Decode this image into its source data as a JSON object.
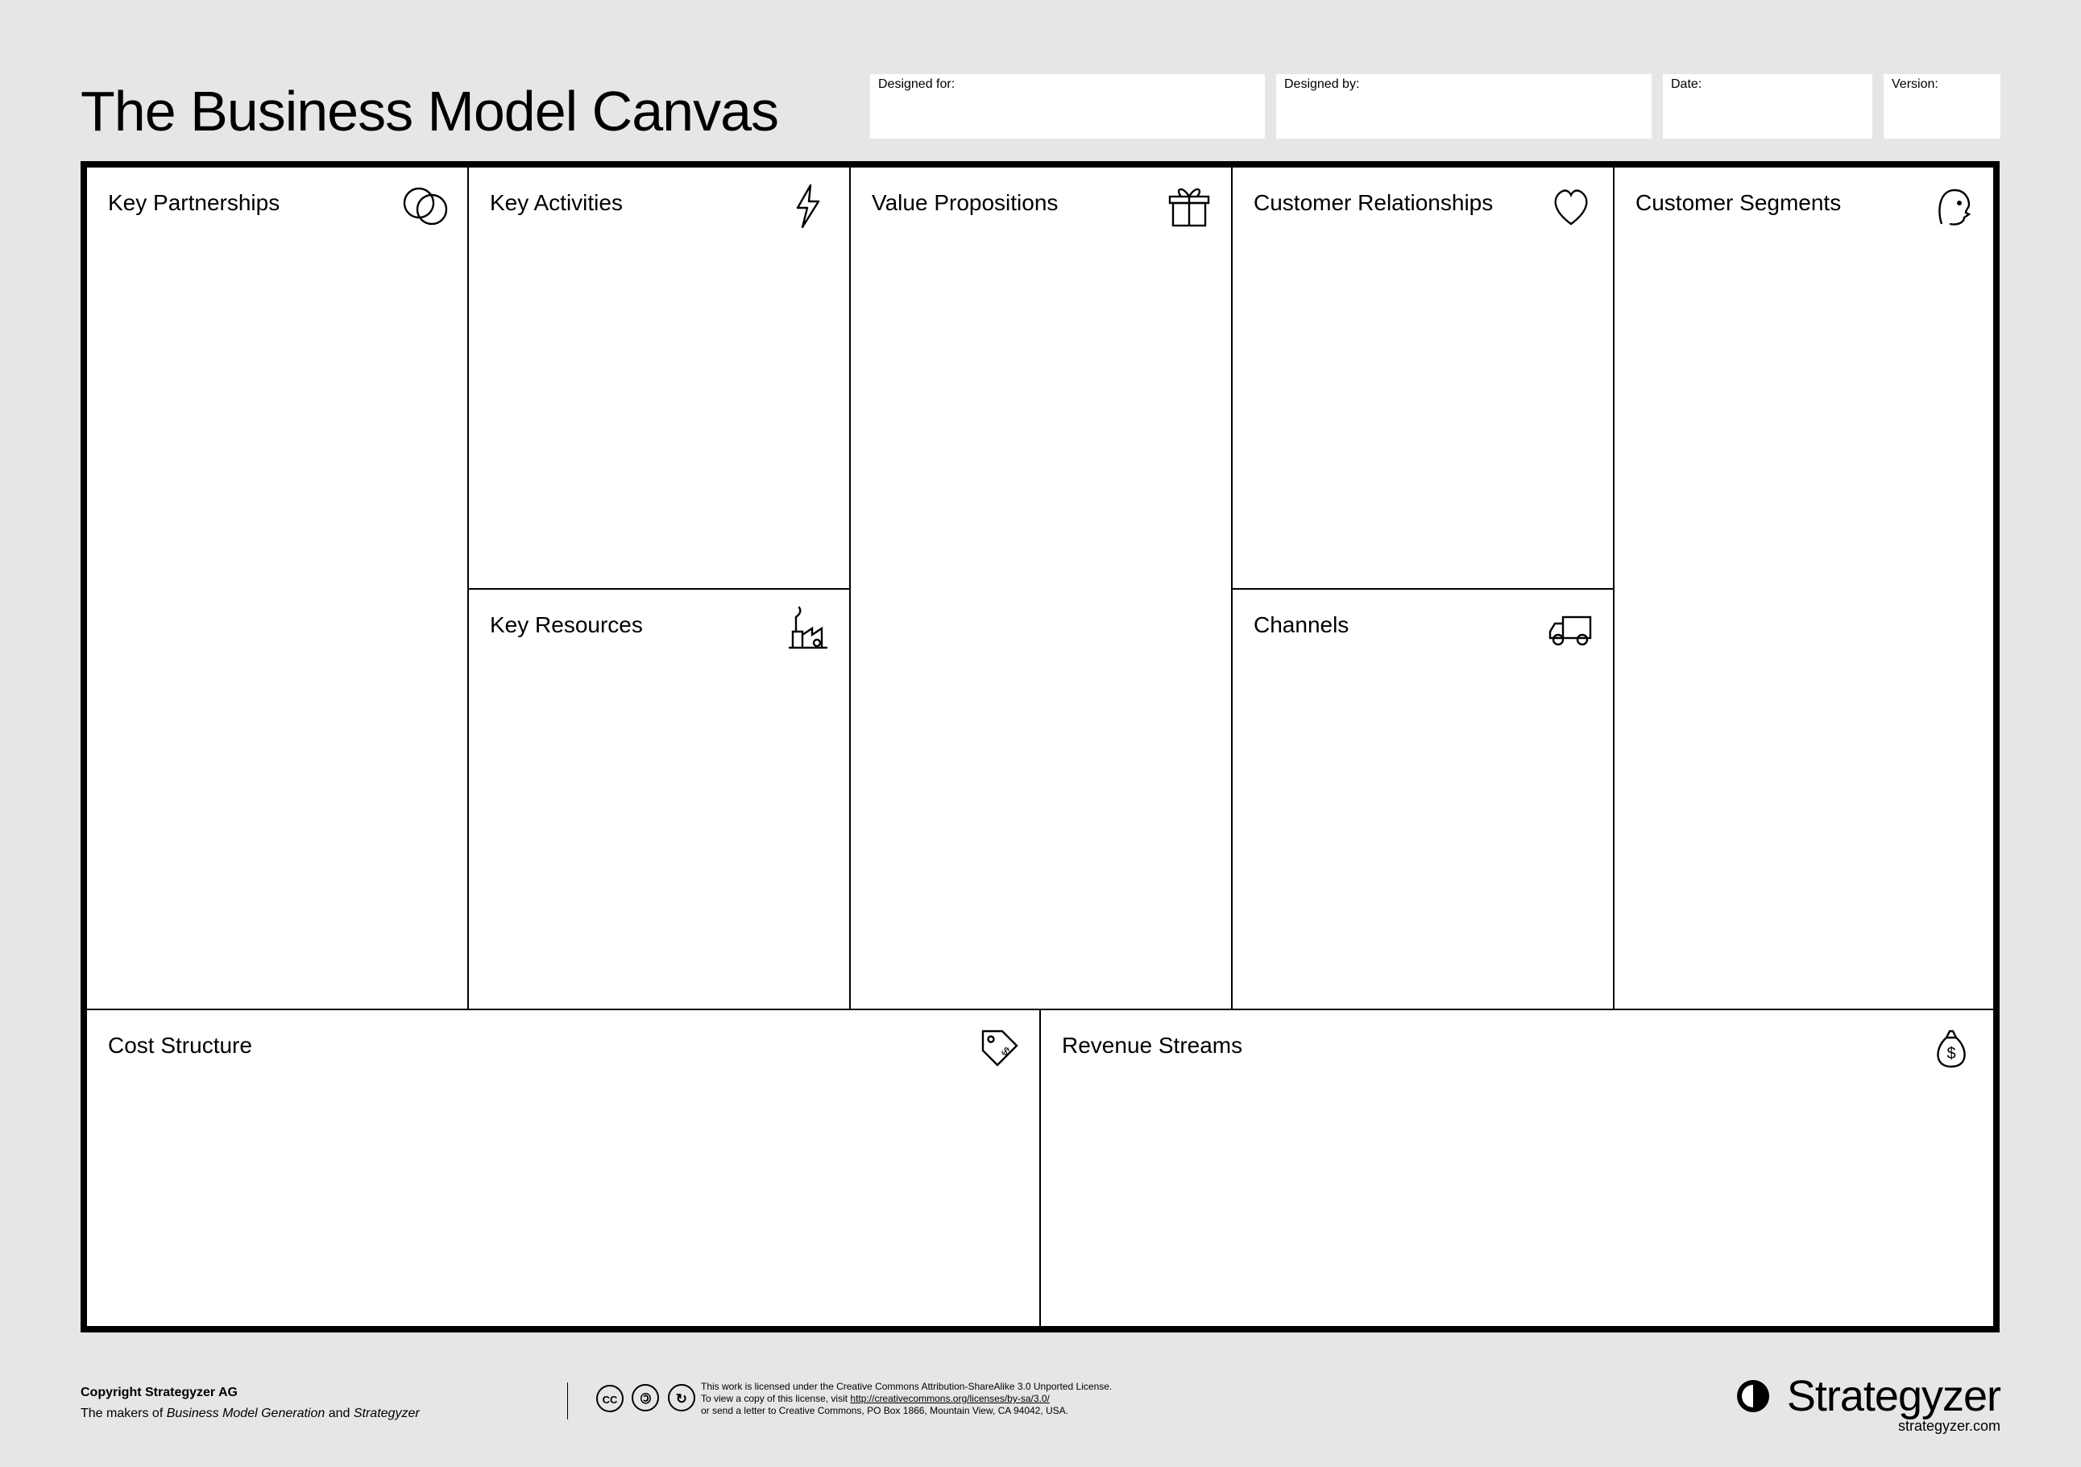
{
  "title": "The Business Model Canvas",
  "header": {
    "designed_for": {
      "label": "Designed for:",
      "value": ""
    },
    "designed_by": {
      "label": "Designed by:",
      "value": ""
    },
    "date": {
      "label": "Date:",
      "value": ""
    },
    "version": {
      "label": "Version:",
      "value": ""
    }
  },
  "cells": {
    "key_partnerships": {
      "title": "Key Partnerships",
      "icon": "link-rings-icon"
    },
    "key_activities": {
      "title": "Key Activities",
      "icon": "lightning-icon"
    },
    "key_resources": {
      "title": "Key Resources",
      "icon": "factory-icon"
    },
    "value_propositions": {
      "title": "Value Propositions",
      "icon": "gift-icon"
    },
    "customer_relationships": {
      "title": "Customer Relationships",
      "icon": "heart-icon"
    },
    "channels": {
      "title": "Channels",
      "icon": "truck-icon"
    },
    "customer_segments": {
      "title": "Customer Segments",
      "icon": "person-head-icon"
    },
    "cost_structure": {
      "title": "Cost Structure",
      "icon": "price-tag-icon"
    },
    "revenue_streams": {
      "title": "Revenue Streams",
      "icon": "money-bag-icon"
    }
  },
  "footer": {
    "copyright": "Copyright Strategyzer AG",
    "makers_prefix": "The makers of ",
    "makers_em1": "Business Model Generation",
    "makers_mid": " and ",
    "makers_em2": "Strategyzer",
    "cc": {
      "cc": "CC",
      "by": "①",
      "sa": "②"
    },
    "license_line1": "This work is licensed under the Creative Commons Attribution-ShareAlike 3.0 Unported License.",
    "license_line2a": "To view a copy of this license, visit ",
    "license_url": "http://creativecommons.org/licenses/by-sa/3.0/",
    "license_line3": "or send a letter to Creative Commons, PO Box 1866, Mountain View, CA 94042, USA.",
    "brand_mark": "ᕦ",
    "brand_name": "Strategyzer",
    "brand_url": "strategyzer.com"
  }
}
